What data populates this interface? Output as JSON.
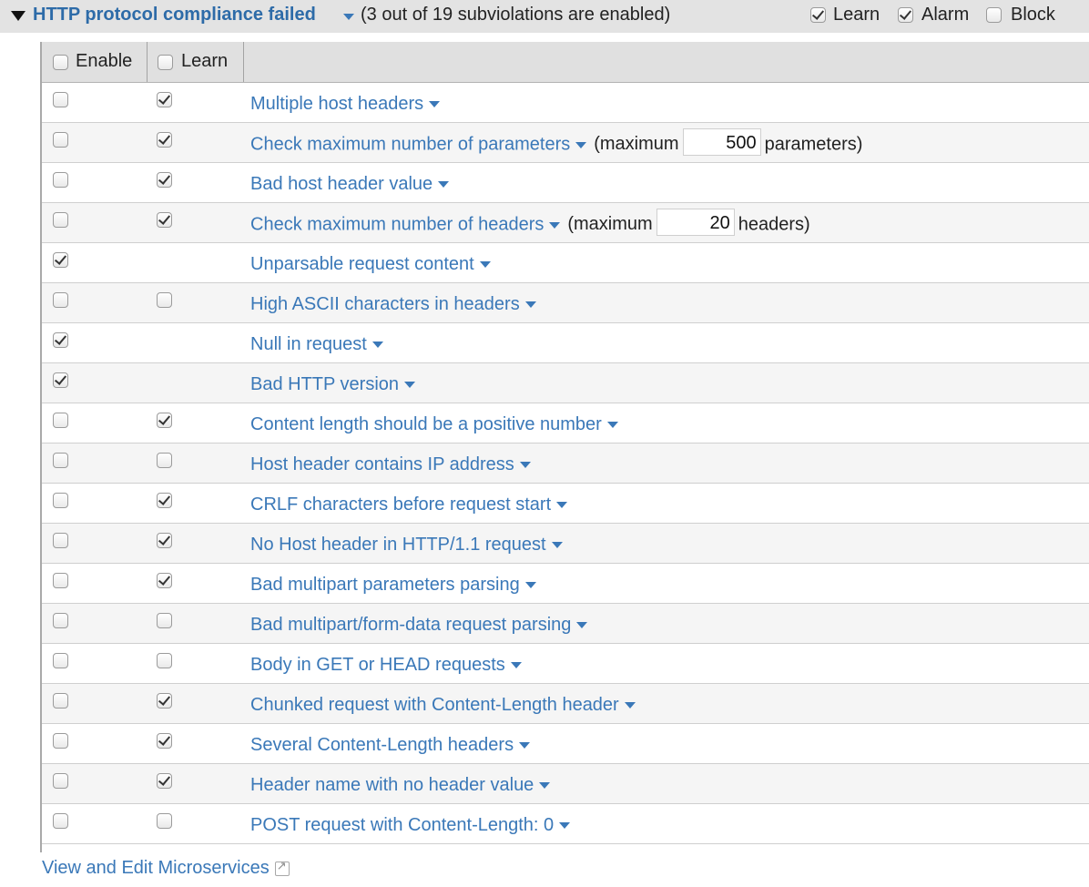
{
  "header": {
    "title": "HTTP protocol compliance failed",
    "summary": "(3 out of 19 subviolations are enabled)",
    "options": [
      {
        "label": "Learn",
        "checked": true
      },
      {
        "label": "Alarm",
        "checked": true
      },
      {
        "label": "Block",
        "checked": false
      }
    ]
  },
  "table": {
    "col_enable": {
      "label": "Enable",
      "checked": false
    },
    "col_learn": {
      "label": "Learn",
      "checked": false
    },
    "rows": [
      {
        "name": "Multiple host headers",
        "enable": false,
        "learn": true
      },
      {
        "name": "Check maximum number of parameters",
        "enable": false,
        "learn": true,
        "param": {
          "prefix": "(maximum",
          "value": "500",
          "suffix": "parameters)"
        }
      },
      {
        "name": "Bad host header value",
        "enable": false,
        "learn": true
      },
      {
        "name": "Check maximum number of headers",
        "enable": false,
        "learn": true,
        "param": {
          "prefix": "(maximum",
          "value": "20",
          "suffix": "headers)"
        }
      },
      {
        "name": "Unparsable request content",
        "enable": true,
        "learn": null
      },
      {
        "name": "High ASCII characters in headers",
        "enable": false,
        "learn": false
      },
      {
        "name": "Null in request",
        "enable": true,
        "learn": null
      },
      {
        "name": "Bad HTTP version",
        "enable": true,
        "learn": null
      },
      {
        "name": "Content length should be a positive number",
        "enable": false,
        "learn": true
      },
      {
        "name": "Host header contains IP address",
        "enable": false,
        "learn": false
      },
      {
        "name": "CRLF characters before request start",
        "enable": false,
        "learn": true
      },
      {
        "name": "No Host header in HTTP/1.1 request",
        "enable": false,
        "learn": true
      },
      {
        "name": "Bad multipart parameters parsing",
        "enable": false,
        "learn": true
      },
      {
        "name": "Bad multipart/form-data request parsing",
        "enable": false,
        "learn": false
      },
      {
        "name": "Body in GET or HEAD requests",
        "enable": false,
        "learn": false
      },
      {
        "name": "Chunked request with Content-Length header",
        "enable": false,
        "learn": true
      },
      {
        "name": "Several Content-Length headers",
        "enable": false,
        "learn": true
      },
      {
        "name": "Header name with no header value",
        "enable": false,
        "learn": true
      },
      {
        "name": "POST request with Content-Length: 0",
        "enable": false,
        "learn": false
      }
    ]
  },
  "footer": {
    "link_label": "View and Edit Microservices",
    "link_icon": "external-link-icon"
  },
  "colors": {
    "link": "#3a78b8",
    "title": "#2d6ba8",
    "header_bg": "#e3e3e3",
    "row_alt_bg": "#f5f5f5"
  }
}
